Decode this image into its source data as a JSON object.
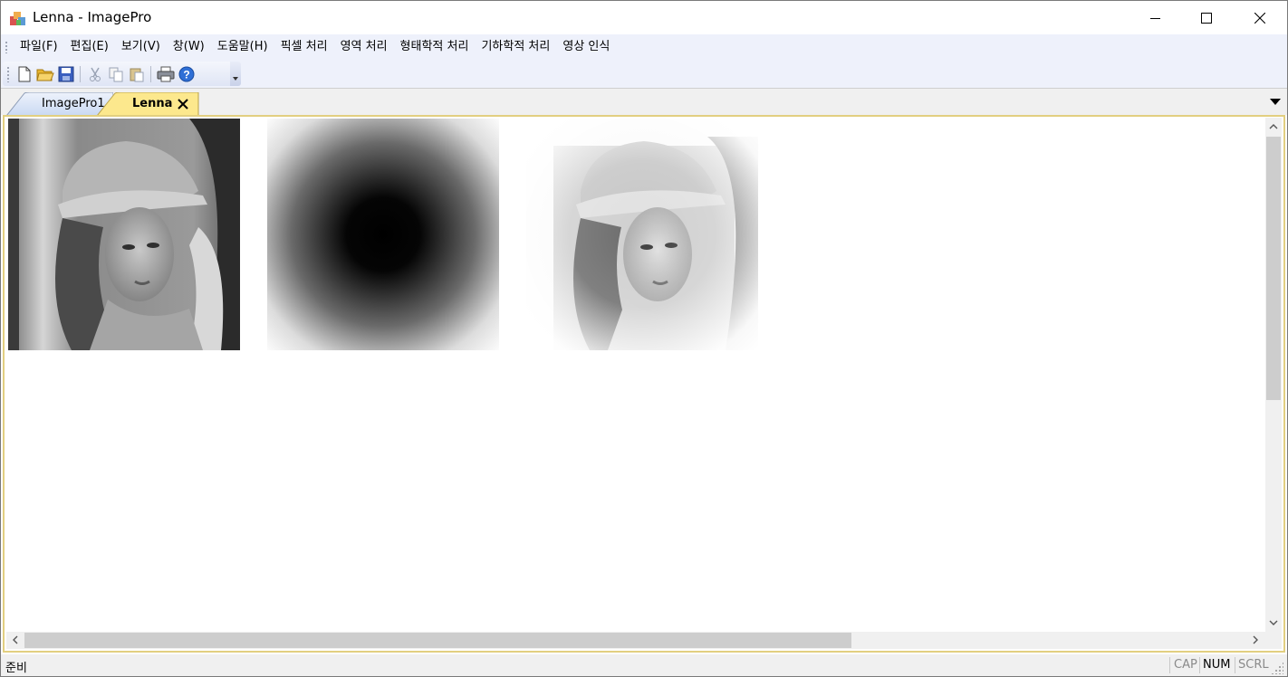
{
  "window": {
    "title": "Lenna - ImagePro"
  },
  "menubar": {
    "items": [
      {
        "label": "파일(F)"
      },
      {
        "label": "편집(E)"
      },
      {
        "label": "보기(V)"
      },
      {
        "label": "창(W)"
      },
      {
        "label": "도움말(H)"
      },
      {
        "label": "픽셀 처리"
      },
      {
        "label": "영역 처리"
      },
      {
        "label": "형태학적 처리"
      },
      {
        "label": "기하학적 처리"
      },
      {
        "label": "영상 인식"
      }
    ]
  },
  "toolbar": {
    "buttons": [
      "new-file-icon",
      "open-folder-icon",
      "save-disk-icon",
      "cut-scissors-icon",
      "copy-icon",
      "paste-icon",
      "print-icon",
      "help-icon"
    ]
  },
  "tabs": [
    {
      "label": "ImagePro1",
      "active": false
    },
    {
      "label": "Lenna",
      "active": true
    }
  ],
  "images": [
    {
      "name": "original-lenna"
    },
    {
      "name": "radial-gradient-mask"
    },
    {
      "name": "masked-lenna"
    }
  ],
  "statusbar": {
    "text": "준비",
    "cap": "CAP",
    "num": "NUM",
    "scrl": "SCRL"
  },
  "colors": {
    "menu_bg": "#eef1fb",
    "active_tab": "#fce88d",
    "inactive_tab": "#d6e3f7",
    "doc_border": "#e2cf80"
  }
}
